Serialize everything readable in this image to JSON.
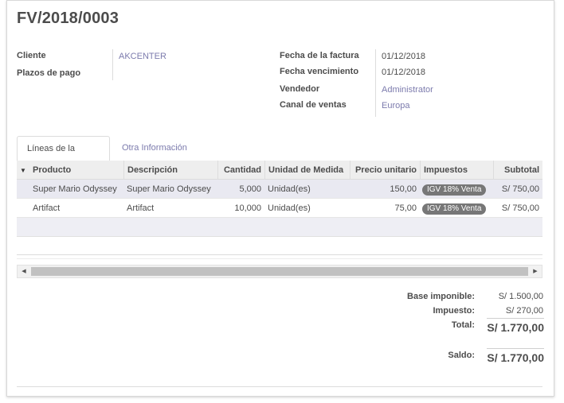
{
  "invoice": {
    "title": "FV/2018/0003"
  },
  "left_fields": {
    "cliente_label": "Cliente",
    "cliente_value": "AKCENTER",
    "plazos_label": "Plazos de pago"
  },
  "right_fields": {
    "fecha_factura_label": "Fecha de la factura",
    "fecha_factura_value": "01/12/2018",
    "fecha_venc_label": "Fecha vencimiento",
    "fecha_venc_value": "01/12/2018",
    "vendedor_label": "Vendedor",
    "vendedor_value": "Administrator",
    "canal_label": "Canal de ventas",
    "canal_value": "Europa"
  },
  "tabs": [
    {
      "label": "Líneas de la factura",
      "active": true
    },
    {
      "label": "Otra Información",
      "active": false
    }
  ],
  "table": {
    "sort_icon": "caret-down-icon",
    "headers": {
      "producto": "Producto",
      "descripcion": "Descripción",
      "cantidad": "Cantidad",
      "unidad": "Unidad de Medida",
      "precio": "Precio unitario",
      "impuestos": "Impuestos",
      "subtotal": "Subtotal"
    },
    "rows": [
      {
        "producto": "Super Mario Odyssey",
        "descripcion": "Super Mario Odyssey",
        "cantidad": "5,000",
        "unidad": "Unidad(es)",
        "precio": "150,00",
        "impuesto": "IGV 18% Venta",
        "subtotal": "S/ 750,00"
      },
      {
        "producto": "Artifact",
        "descripcion": "Artifact",
        "cantidad": "10,000",
        "unidad": "Unidad(es)",
        "precio": "75,00",
        "impuesto": "IGV 18% Venta",
        "subtotal": "S/ 750,00"
      }
    ]
  },
  "totals": {
    "base_label": "Base imponible:",
    "base_value": "S/ 1.500,00",
    "impuesto_label": "Impuesto:",
    "impuesto_value": "S/ 270,00",
    "total_label": "Total:",
    "total_value": "S/ 1.770,00",
    "saldo_label": "Saldo:",
    "saldo_value": "S/ 1.770,00"
  },
  "colors": {
    "link": "#7c7bad",
    "badge": "#777777",
    "selected_row": "#e9e9f1"
  }
}
